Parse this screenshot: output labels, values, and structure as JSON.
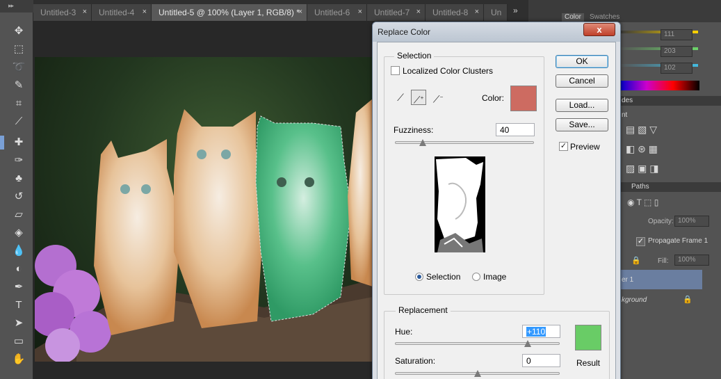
{
  "tabs": [
    {
      "label": "Untitled-3",
      "close": "×"
    },
    {
      "label": "Untitled-4",
      "close": "×"
    },
    {
      "label": "Untitled-5 @ 100% (Layer 1, RGB/8) *",
      "close": "×"
    },
    {
      "label": "Untitled-6",
      "close": "×"
    },
    {
      "label": "Untitled-7",
      "close": "×"
    },
    {
      "label": "Untitled-8",
      "close": "×"
    },
    {
      "label": "Un",
      "close": ""
    }
  ],
  "tab_overflow": "»",
  "right_panel": {
    "tabs": [
      "Color",
      "Swatches"
    ],
    "color_values": [
      "111",
      "203",
      "102"
    ],
    "adjustments_partial": "des",
    "adjustments_sub": "nt",
    "layers_tab": "Paths",
    "opacity_label": "Opacity:",
    "opacity_value": "100%",
    "propagate_label": "Propagate Frame 1",
    "fill_label": "Fill:",
    "fill_value": "100%",
    "layer1_label": "er 1",
    "background_label": "kground"
  },
  "dialog": {
    "title": "Replace Color",
    "close_glyph": "x",
    "selection": {
      "legend": "Selection",
      "localized_label": "Localized Color Clusters",
      "localized_checked": false,
      "color_label": "Color:",
      "color_hex": "#cd6b61",
      "fuzziness_label": "Fuzziness:",
      "fuzziness_value": "40",
      "fuzziness_max": 200,
      "view_selection_label": "Selection",
      "view_image_label": "Image",
      "view_mode": "selection"
    },
    "buttons": {
      "ok": "OK",
      "cancel": "Cancel",
      "load": "Load...",
      "save": "Save..."
    },
    "preview_label": "Preview",
    "preview_checked": true,
    "replacement": {
      "legend": "Replacement",
      "hue_label": "Hue:",
      "hue_value": "+110",
      "hue_position": 0.806,
      "saturation_label": "Saturation:",
      "saturation_value": "0",
      "saturation_position": 0.5,
      "result_label": "Result",
      "result_hex": "#69cc66"
    }
  },
  "colors": {
    "ui_dark": "#3a3a3a",
    "panel": "#535353",
    "active_tab": "#595959",
    "accent_selection": "#3399ff"
  }
}
